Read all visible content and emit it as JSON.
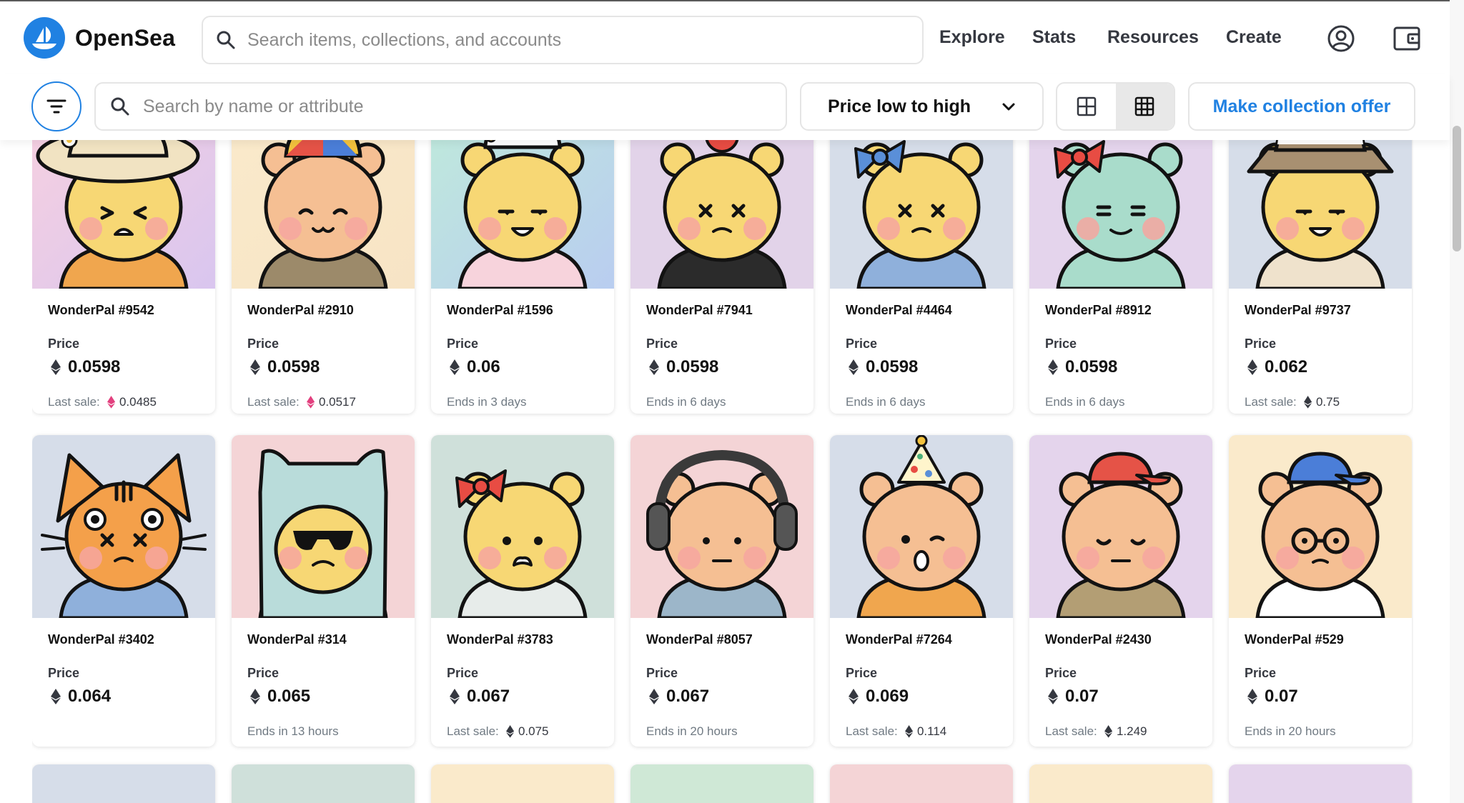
{
  "app": {
    "name": "OpenSea",
    "brand_color": "#2081e2"
  },
  "search": {
    "placeholder": "Search items, collections, and accounts"
  },
  "nav": {
    "explore": "Explore",
    "stats": "Stats",
    "resources": "Resources",
    "create": "Create"
  },
  "filters": {
    "attribute_placeholder": "Search by name or attribute",
    "sort_value": "Price low to high",
    "offer_label": "Make collection offer"
  },
  "items": [
    {
      "name": "WonderPal #9542",
      "price_label": "Price",
      "price": "0.0598",
      "foot": "Last sale:",
      "last_sale": "0.0485",
      "sale_icon": "eth-pink",
      "bg": [
        "#f7d0e0",
        "#d9c6ef"
      ],
      "skin": "#f7d774",
      "face": "squint",
      "acc": "sunhat",
      "shirt": "#f0a64e"
    },
    {
      "name": "WonderPal #2910",
      "price_label": "Price",
      "price": "0.0598",
      "foot": "Last sale:",
      "last_sale": "0.0517",
      "sale_icon": "eth-pink",
      "bg": [
        "#faeacb",
        "#f7e4c5"
      ],
      "skin": "#f5bf93",
      "face": "happy",
      "acc": "propeller",
      "shirt": "#9c8a6a"
    },
    {
      "name": "WonderPal #1596",
      "price_label": "Price",
      "price": "0.06",
      "foot": "Ends in 3 days",
      "last_sale": "",
      "sale_icon": "",
      "bg": [
        "#bfeadb",
        "#b9cdf0"
      ],
      "skin": "#f7d774",
      "face": "smirk",
      "acc": "sailor",
      "shirt": "#f7d3dc"
    },
    {
      "name": "WonderPal #7941",
      "price_label": "Price",
      "price": "0.0598",
      "foot": "Ends in 6 days",
      "last_sale": "",
      "sale_icon": "",
      "bg": [
        "#e2d3e9",
        "#e2d3e9"
      ],
      "skin": "#f7d774",
      "face": "xx",
      "acc": "apple",
      "shirt": "#2b2b2b"
    },
    {
      "name": "WonderPal #4464",
      "price_label": "Price",
      "price": "0.0598",
      "foot": "Ends in 6 days",
      "last_sale": "",
      "sale_icon": "",
      "bg": [
        "#d6dde9",
        "#d6dde9"
      ],
      "skin": "#f7d774",
      "face": "xx",
      "acc": "bow-blue",
      "shirt": "#8fb0db"
    },
    {
      "name": "WonderPal #8912",
      "price_label": "Price",
      "price": "0.0598",
      "foot": "Ends in 6 days",
      "last_sale": "",
      "sale_icon": "",
      "bg": [
        "#e4d4ec",
        "#e4d4ec"
      ],
      "skin": "#a9dccb",
      "face": "lines",
      "acc": "bow-red",
      "shirt": "#a9dccb"
    },
    {
      "name": "WonderPal #9737",
      "price_label": "Price",
      "price": "0.062",
      "foot": "Last sale:",
      "last_sale": "0.75",
      "sale_icon": "eth",
      "bg": [
        "#d6dde9",
        "#d6dde9"
      ],
      "skin": "#f7d774",
      "face": "smirk",
      "acc": "bucket",
      "shirt": "#efe2cc"
    },
    {
      "name": "WonderPal #3402",
      "price_label": "Price",
      "price": "0.064",
      "foot": "",
      "last_sale": "",
      "sale_icon": "",
      "bg": [
        "#d6dde9",
        "#d6dde9"
      ],
      "skin": "#f4a04a",
      "face": "xx",
      "acc": "cat",
      "shirt": "#8fb0db"
    },
    {
      "name": "WonderPal #314",
      "price_label": "Price",
      "price": "0.065",
      "foot": "Ends in 13 hours",
      "last_sale": "",
      "sale_icon": "",
      "bg": [
        "#f4d4d6",
        "#f4d4d6"
      ],
      "skin": "#f7d774",
      "face": "shades",
      "acc": "hood",
      "shirt": "#f0a64e"
    },
    {
      "name": "WonderPal #3783",
      "price_label": "Price",
      "price": "0.067",
      "foot": "Last sale:",
      "last_sale": "0.075",
      "sale_icon": "eth",
      "bg": [
        "#cfe0da",
        "#cfe0da"
      ],
      "skin": "#f7d774",
      "face": "sad",
      "acc": "bow-red",
      "shirt": "#e7ecea"
    },
    {
      "name": "WonderPal #8057",
      "price_label": "Price",
      "price": "0.067",
      "foot": "Ends in 20 hours",
      "last_sale": "",
      "sale_icon": "",
      "bg": [
        "#f4d4d6",
        "#f4d4d6"
      ],
      "skin": "#f5bf93",
      "face": "flat",
      "acc": "headphones",
      "shirt": "#9cb6c9"
    },
    {
      "name": "WonderPal #7264",
      "price_label": "Price",
      "price": "0.069",
      "foot": "Last sale:",
      "last_sale": "0.114",
      "sale_icon": "eth",
      "bg": [
        "#d6dde9",
        "#d6dde9"
      ],
      "skin": "#f5bf93",
      "face": "wow",
      "acc": "partyhat",
      "shirt": "#f0a64e"
    },
    {
      "name": "WonderPal #2430",
      "price_label": "Price",
      "price": "0.07",
      "foot": "Last sale:",
      "last_sale": "1.249",
      "sale_icon": "eth",
      "bg": [
        "#e4d4ec",
        "#e4d4ec"
      ],
      "skin": "#f5bf93",
      "face": "sleepy",
      "acc": "cap-red",
      "shirt": "#b39e74"
    },
    {
      "name": "WonderPal #529",
      "price_label": "Price",
      "price": "0.07",
      "foot": "Ends in 20 hours",
      "last_sale": "",
      "sale_icon": "",
      "bg": [
        "#faeacb",
        "#faeacb"
      ],
      "skin": "#f5bf93",
      "face": "glasses",
      "acc": "cap-blue",
      "shirt": "#ffffff"
    }
  ],
  "peek_row_colors": [
    "#d6dde9",
    "#cfe0da",
    "#faeacb",
    "#cfe8d6",
    "#f4d4d6",
    "#faeacb",
    "#e4d4ec"
  ]
}
